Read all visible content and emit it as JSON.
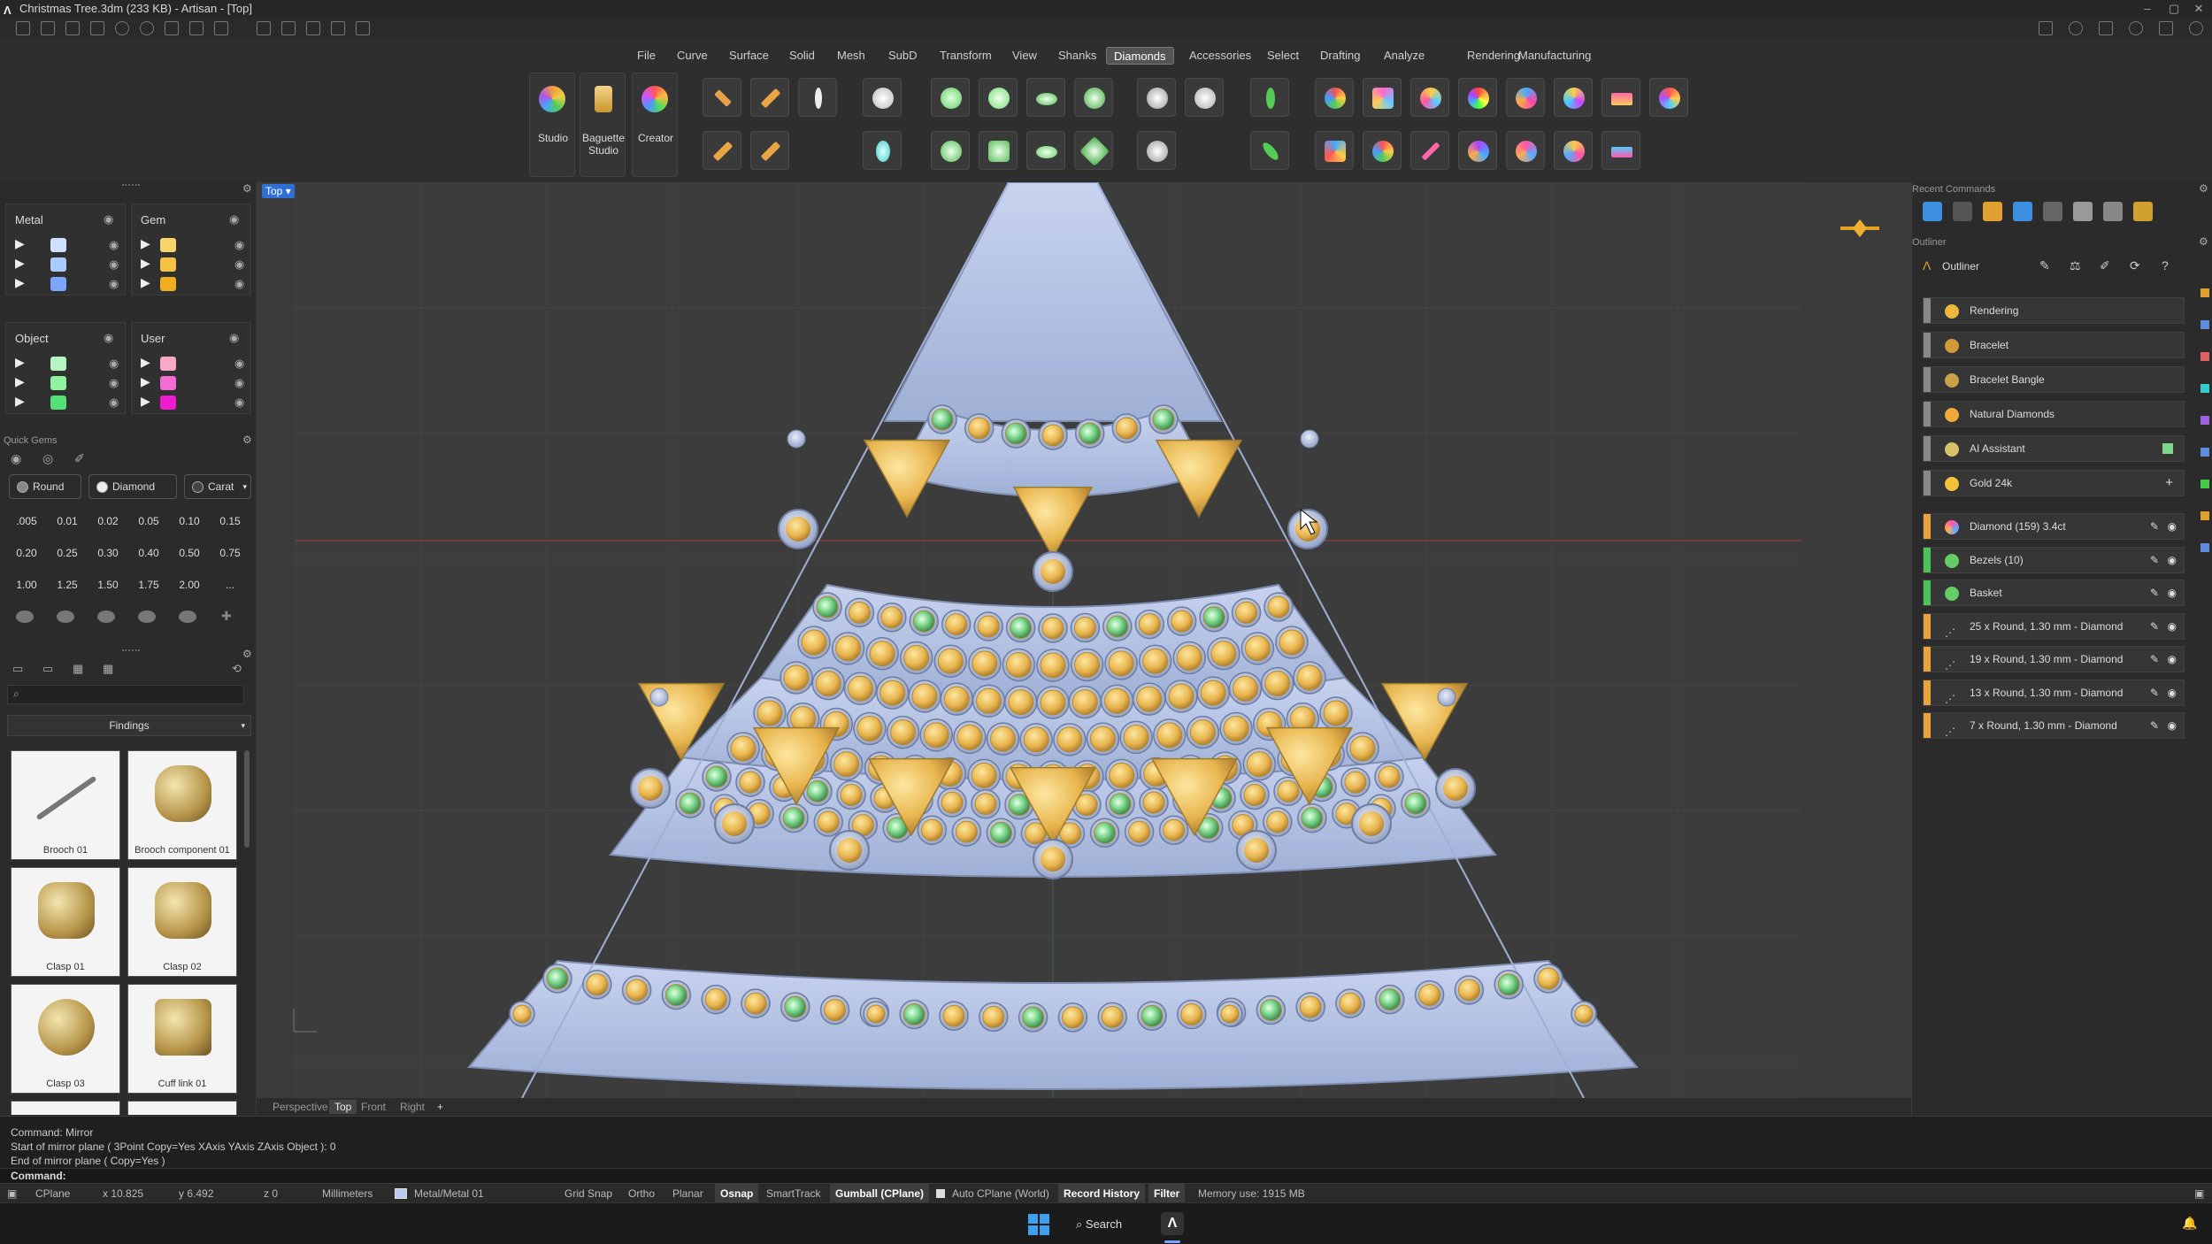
{
  "titlebar": {
    "title": "Christmas Tree.3dm (233 KB) - Artisan - [Top]",
    "minimize": "–",
    "maximize": "▢",
    "close": "✕"
  },
  "menu": [
    "File",
    "Curve",
    "Surface",
    "Solid",
    "Mesh",
    "SubD",
    "Transform",
    "View",
    "Shanks",
    "Diamonds",
    "Accessories",
    "Select",
    "Drafting",
    "Analyze",
    "Rendering",
    "Manufacturing"
  ],
  "menu_active": "Diamonds",
  "ribbon": {
    "studio": "Studio",
    "baguette_studio": "Baguette\nStudio",
    "creator": "Creator"
  },
  "left": {
    "metal": "Metal",
    "gem": "Gem",
    "object": "Object",
    "user": "User",
    "metal_colors": [
      "#cde0ff",
      "#aacbff",
      "#7aa6ff"
    ],
    "gem_colors": [
      "#f7d56a",
      "#f5c242",
      "#f0ad1d"
    ],
    "object_colors": [
      "#b6f5c2",
      "#8ef29e",
      "#53e079"
    ],
    "user_colors": [
      "#f9a8c7",
      "#f46bd4",
      "#f01ad0"
    ],
    "quick_gems": "Quick Gems",
    "round": "Round",
    "diamond": "Diamond",
    "carat": "Carat",
    "carats": [
      ".005",
      "0.01",
      "0.02",
      "0.05",
      "0.10",
      "0.15",
      "0.20",
      "0.25",
      "0.30",
      "0.40",
      "0.50",
      "0.75",
      "1.00",
      "1.25",
      "1.50",
      "1.75",
      "2.00",
      "..."
    ],
    "findings": "Findings",
    "items": [
      "Brooch 01",
      "Brooch component 01",
      "Clasp 01",
      "Clasp 02",
      "Clasp 03",
      "Cuff link 01"
    ]
  },
  "viewport": {
    "label": "Top",
    "tabs": [
      "Perspective",
      "Top",
      "Front",
      "Right"
    ],
    "add_tab": "+"
  },
  "right": {
    "recent_commands": "Recent Commands",
    "outliner_section": "Outliner",
    "outliner_title": "Outliner",
    "materials": [
      {
        "name": "Rendering",
        "color": "#f0b63a"
      },
      {
        "name": "Bracelet",
        "color": "#d49a3a"
      },
      {
        "name": "Bracelet Bangle",
        "color": "#caa04a"
      },
      {
        "name": "Natural Diamonds",
        "color": "#f1a93a"
      },
      {
        "name": "AI Assistant",
        "color": "#d9c06a"
      },
      {
        "name": "Gold 24k",
        "color": "#f3c23a"
      }
    ],
    "objects": [
      {
        "name": "Diamond (159) 3.4ct",
        "stripe": "#e8a33a"
      },
      {
        "name": "Bezels (10)",
        "stripe": "#4ec35a"
      },
      {
        "name": "Basket",
        "stripe": "#4ec35a"
      },
      {
        "name": "25 x Round, 1.30 mm - Diamond",
        "stripe": "#e8a33a"
      },
      {
        "name": "19 x Round, 1.30 mm - Diamond",
        "stripe": "#e8a33a"
      },
      {
        "name": "13 x Round, 1.30 mm - Diamond",
        "stripe": "#e8a33a"
      },
      {
        "name": "7 x Round, 1.30 mm - Diamond",
        "stripe": "#e8a33a"
      }
    ]
  },
  "command": {
    "lines": [
      "Command: Mirror",
      "Start of mirror plane ( 3Point  Copy=Yes  XAxis  YAxis  ZAxis  Object ): 0",
      "End of mirror plane ( Copy=Yes )"
    ],
    "prompt": "Command:"
  },
  "status": {
    "cplane": "CPlane",
    "x": "x 10.825",
    "y": "y 6.492",
    "z": "z 0",
    "units": "Millimeters",
    "layer": "Metal/Metal 01",
    "grid_snap": "Grid Snap",
    "ortho": "Ortho",
    "planar": "Planar",
    "osnap": "Osnap",
    "smarttrack": "SmartTrack",
    "gumball": "Gumball (CPlane)",
    "auto_cplane": "Auto CPlane (World)",
    "record_history": "Record History",
    "filter": "Filter",
    "memory": "Memory use: 1915 MB"
  },
  "taskbar": {
    "search": "Search"
  }
}
